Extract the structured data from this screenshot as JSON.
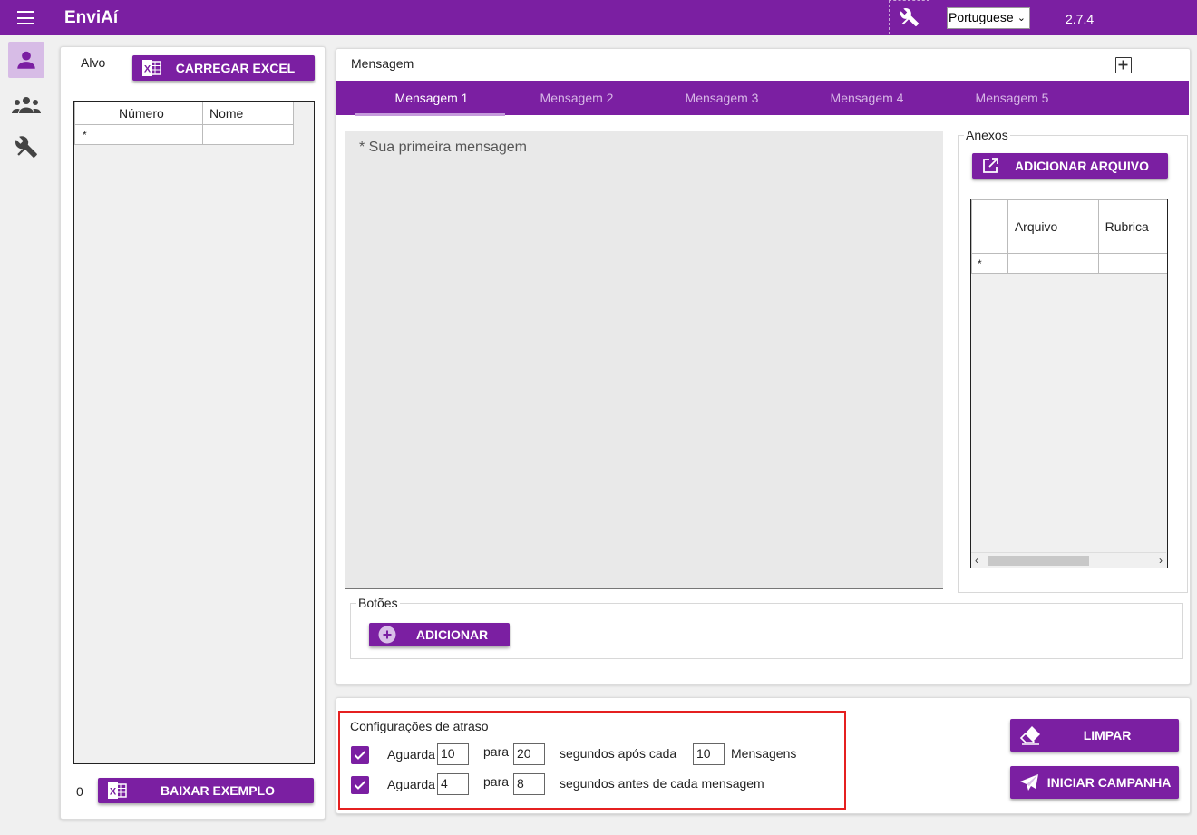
{
  "app": {
    "title": "EnviAí",
    "version": "2.7.4"
  },
  "header": {
    "language": "Portuguese"
  },
  "target": {
    "title": "Alvo",
    "load_excel_label": "CARREGAR EXCEL",
    "columns": [
      "Número",
      "Nome"
    ],
    "new_row_marker": "*",
    "count": "0",
    "download_example_label": "BAIXAR EXEMPLO"
  },
  "message": {
    "title": "Mensagem",
    "tabs": [
      "Mensagem 1",
      "Mensagem 2",
      "Mensagem 3",
      "Mensagem 4",
      "Mensagem 5"
    ],
    "placeholder": "* Sua primeira mensagem",
    "buttons_title": "Botões",
    "add_button_label": "ADICIONAR"
  },
  "attachments": {
    "title": "Anexos",
    "add_file_label": "ADICIONAR ARQUIVO",
    "columns": [
      "Arquivo",
      "Rubrica"
    ],
    "new_row_marker": "*"
  },
  "delay": {
    "title": "Configurações de atraso",
    "row1": {
      "wait_label": "Aguarda",
      "from": "10",
      "to_label": "para",
      "to": "20",
      "after_label": "segundos após cada",
      "count": "10",
      "messages_label": "Mensagens"
    },
    "row2": {
      "wait_label": "Aguarda",
      "from": "4",
      "to_label": "para",
      "to": "8",
      "before_label": "segundos antes de cada mensagem"
    }
  },
  "actions": {
    "clear_label": "LIMPAR",
    "start_label": "INICIAR CAMPANHA"
  },
  "colors": {
    "primary": "#7b1fa2",
    "highlight": "#e52020"
  }
}
